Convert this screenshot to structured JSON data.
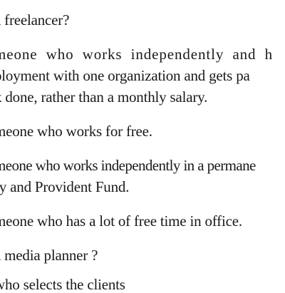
{
  "document": {
    "question1": {
      "text": "a freelancer?",
      "options": [
        {
          "lines": [
            "meone  who  works  independently  and  h",
            "ployment with one organization and gets pa",
            "k done, rather than a monthly salary."
          ]
        },
        {
          "lines": [
            "meone who works for free."
          ]
        },
        {
          "lines": [
            "meone who works independently in a permane",
            "ry and Provident Fund."
          ]
        },
        {
          "lines": [
            "meone who has a lot of free time in  office."
          ]
        }
      ]
    },
    "question2": {
      "text": "a media planner ?",
      "partial_line": "who selects the clients"
    }
  }
}
